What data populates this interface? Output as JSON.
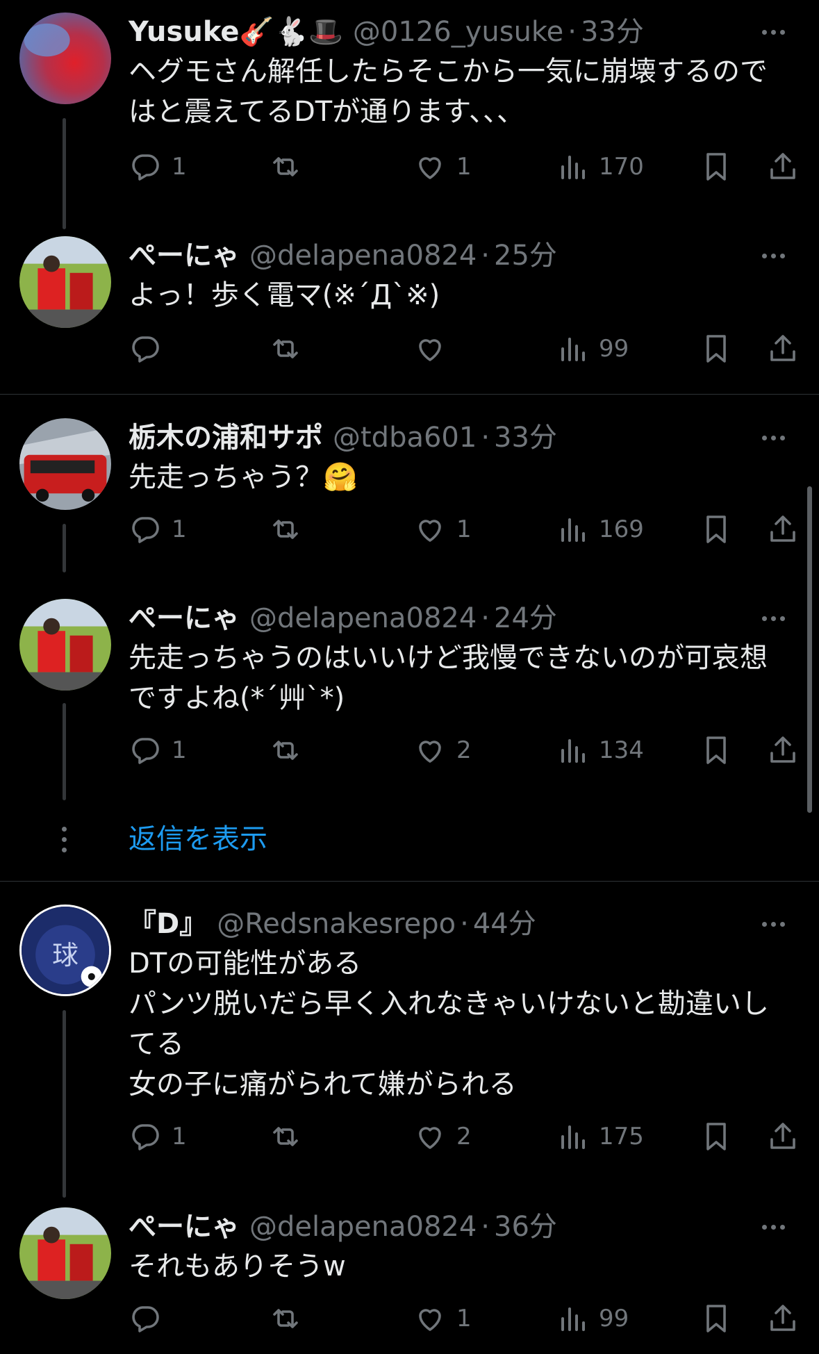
{
  "tweets": [
    {
      "name": "Yusuke",
      "name_emoji": "🎸🐇🎩",
      "handle": "@0126_yusuke",
      "time": "33分",
      "text": "ヘグモさん解任したらそこから一気に崩壊するのではと震えてるDTが通ります、、、",
      "replies": "1",
      "retweets": "",
      "likes": "1",
      "views": "170"
    },
    {
      "name": "ぺーにゃ",
      "handle": "@delapena0824",
      "time": "25分",
      "text": "よっ！歩く電マ(※´Д`※)",
      "replies": "",
      "retweets": "",
      "likes": "",
      "views": "99"
    },
    {
      "name": "栃木の浦和サポ",
      "handle": "@tdba601",
      "time": "33分",
      "text": "先走っちゃう？🤗",
      "replies": "1",
      "retweets": "",
      "likes": "1",
      "views": "169"
    },
    {
      "name": "ぺーにゃ",
      "handle": "@delapena0824",
      "time": "24分",
      "text": "先走っちゃうのはいいけど我慢できないのが可哀想ですよね(*´艸`*)",
      "replies": "1",
      "retweets": "",
      "likes": "2",
      "views": "134"
    },
    {
      "name": "『D』",
      "handle": "@Redsnakesrepo",
      "time": "44分",
      "text": "DTの可能性がある\nパンツ脱いだら早く入れなきゃいけないと勘違いしてる\n女の子に痛がられて嫌がられる",
      "replies": "1",
      "retweets": "",
      "likes": "2",
      "views": "175"
    },
    {
      "name": "ぺーにゃ",
      "handle": "@delapena0824",
      "time": "36分",
      "text": "それもありそうw",
      "replies": "",
      "retweets": "",
      "likes": "1",
      "views": "99"
    }
  ],
  "show_replies_label": "返信を表示",
  "colors": {
    "background": "#000000",
    "text": "#e7e9ea",
    "muted": "#71767b",
    "link": "#1d9bf0",
    "divider": "#2f3336"
  },
  "icons": [
    "reply-icon",
    "retweet-icon",
    "like-icon",
    "views-icon",
    "bookmark-icon",
    "share-icon",
    "more-icon"
  ]
}
